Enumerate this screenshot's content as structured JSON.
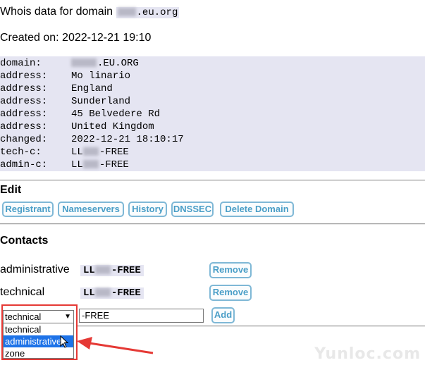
{
  "header": {
    "title_prefix": "Whois data for domain",
    "title_domain_suffix": ".eu.org",
    "created_label": "Created on: 2022-12-21 19:10"
  },
  "whois": [
    {
      "key": "domain:",
      "value": ".EU.ORG"
    },
    {
      "key": "address:",
      "value": "Mo linario"
    },
    {
      "key": "address:",
      "value": "England"
    },
    {
      "key": "address:",
      "value": "Sunderland"
    },
    {
      "key": "address:",
      "value": "45 Belvedere Rd"
    },
    {
      "key": "address:",
      "value": "United Kingdom"
    },
    {
      "key": "changed:",
      "value": "2022-12-21 18:10:17"
    },
    {
      "key": "tech-c:",
      "value": "LL",
      "suffix": "-FREE"
    },
    {
      "key": "admin-c:",
      "value": "LL",
      "suffix": "-FREE"
    }
  ],
  "edit": {
    "heading": "Edit",
    "buttons": [
      "Registrant",
      "Nameservers",
      "History",
      "DNSSEC",
      "Delete Domain"
    ]
  },
  "contacts": {
    "heading": "Contacts",
    "rows": [
      {
        "role": "administrative",
        "handle_prefix": "LL",
        "handle_suffix": "-FREE",
        "button": "Remove"
      },
      {
        "role": "technical",
        "handle_prefix": "LL",
        "handle_suffix": "-FREE",
        "button": "Remove"
      }
    ],
    "add_form": {
      "select_value": "technical",
      "input_value": "-FREE",
      "add_button": "Add",
      "options": [
        "technical",
        "administrative",
        "zone"
      ],
      "highlighted_option": "administrative"
    }
  },
  "watermark": "Yunloc.com",
  "colors": {
    "whois_bg": "#e5e5f2",
    "button_border": "#7fb8d6",
    "button_text": "#4a9ec7",
    "highlight": "#1e73e8",
    "annotation": "#e53935"
  }
}
